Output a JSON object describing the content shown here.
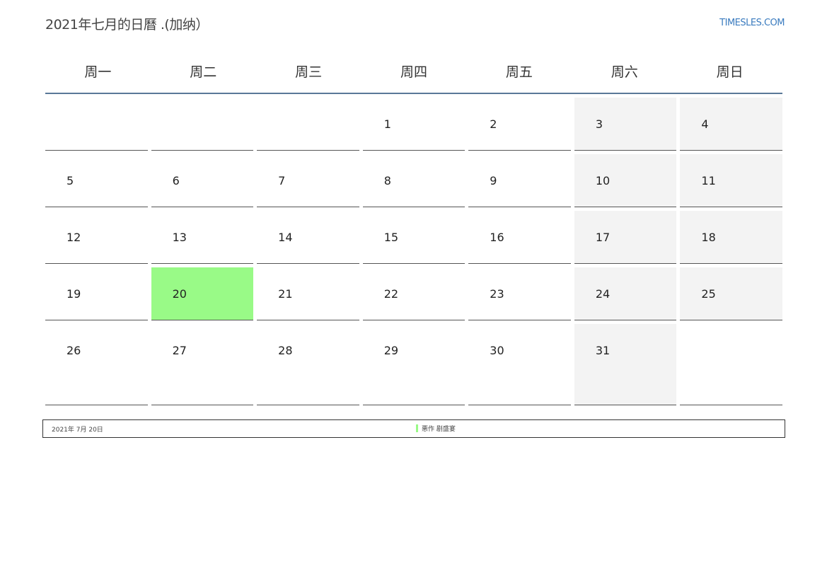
{
  "header": {
    "title": "2021年七月的日曆 .(加纳）",
    "site": "TIMESLES.COM"
  },
  "weekdays": [
    "周一",
    "周二",
    "周三",
    "周四",
    "周五",
    "周六",
    "周日"
  ],
  "weeks": [
    [
      "",
      "",
      "",
      "1",
      "2",
      "3",
      "4"
    ],
    [
      "5",
      "6",
      "7",
      "8",
      "9",
      "10",
      "11"
    ],
    [
      "12",
      "13",
      "14",
      "15",
      "16",
      "17",
      "18"
    ],
    [
      "19",
      "20",
      "21",
      "22",
      "23",
      "24",
      "25"
    ],
    [
      "26",
      "27",
      "28",
      "29",
      "30",
      "31",
      ""
    ]
  ],
  "highlight_day": "20",
  "colors": {
    "highlight": "#99fa87",
    "weekend": "#f3f3f3",
    "rule": "#5a7898",
    "link": "#3a7bbf"
  },
  "footer": {
    "date": "2021年 7月 20日",
    "legend": "悪作 剧盛宴"
  }
}
